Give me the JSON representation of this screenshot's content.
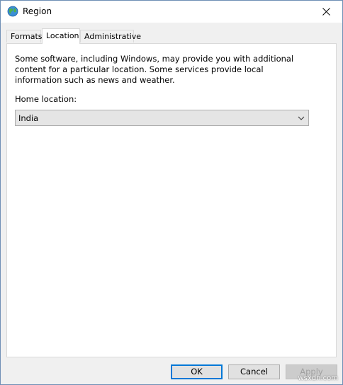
{
  "window": {
    "title": "Region",
    "icon": "globe-icon",
    "close_icon": "close-icon"
  },
  "tabs": [
    {
      "label": "Formats",
      "active": false
    },
    {
      "label": "Location",
      "active": true
    },
    {
      "label": "Administrative",
      "active": false
    }
  ],
  "location": {
    "description": "Some software, including Windows, may provide you with additional content for a particular location. Some services provide local information such as news and weather.",
    "home_label": "Home location:",
    "home_value": "India",
    "chevron_icon": "chevron-down-icon"
  },
  "buttons": {
    "ok": "OK",
    "cancel": "Cancel",
    "apply": "Apply"
  },
  "watermark": "wsxdn.com",
  "colors": {
    "accent": "#0078d7",
    "window_border": "#6f8fb5",
    "dialog_bg": "#f0f0f0"
  }
}
